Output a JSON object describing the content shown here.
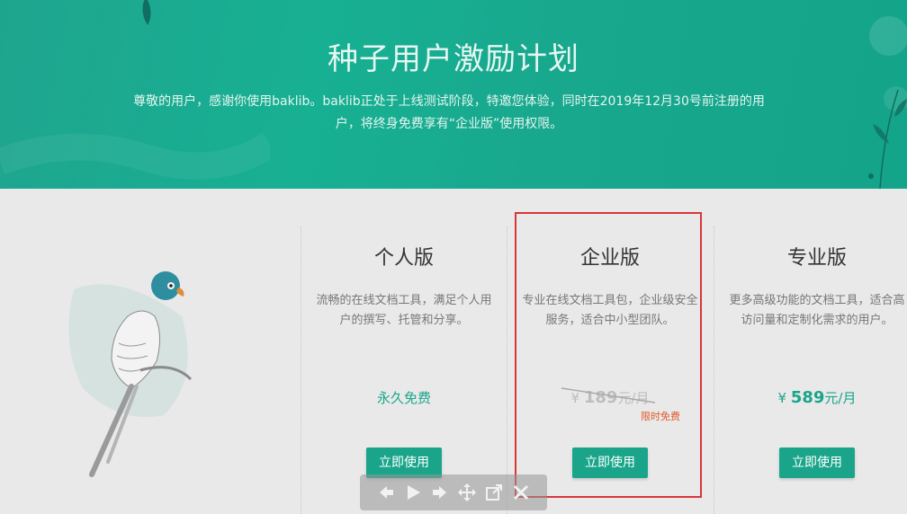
{
  "hero": {
    "title": "种子用户激励计划",
    "description_line1": "尊敬的用户，感谢你使用baklib。baklib正处于上线测试阶段，特邀您体验，同时在2019年12月30号前注册的用",
    "description_line2": "户，将终身免费享有“企业版”使用权限。"
  },
  "plans": [
    {
      "name": "个人版",
      "desc_line1": "流畅的在线文档工具，满足个人用",
      "desc_line2": "户的撰写、托管和分享。",
      "price_text": "永久免费",
      "button": "立即使用"
    },
    {
      "name": "企业版",
      "desc_line1": "专业在线文档工具包，企业级安全",
      "desc_line2": "服务，适合中小型团队。",
      "currency": "¥",
      "price": "189",
      "unit": "元/月",
      "badge": "限时免费",
      "button": "立即使用"
    },
    {
      "name": "专业版",
      "desc_line1": "更多高级功能的文档工具，适合高",
      "desc_line2": "访问量和定制化需求的用户。",
      "currency": "¥",
      "price": "589",
      "unit": "元/月",
      "button": "立即使用"
    }
  ],
  "toolbar": {
    "icons": [
      "arrow-left-icon",
      "play-icon",
      "arrow-right-icon",
      "move-icon",
      "open-external-icon",
      "close-icon"
    ]
  },
  "colors": {
    "accent": "#1aa58b",
    "highlight": "#d9363a",
    "badge": "#e05a2b"
  }
}
